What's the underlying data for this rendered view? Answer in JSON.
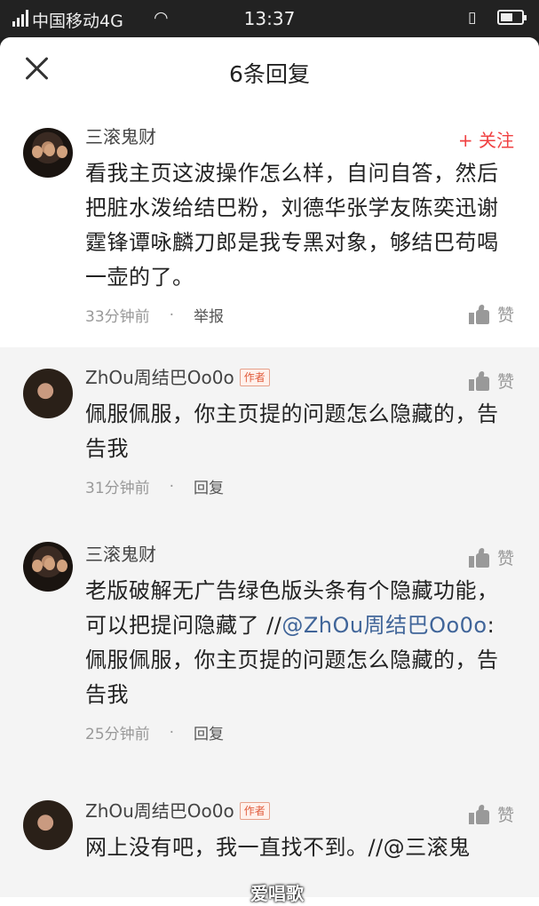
{
  "status_bar": {
    "carrier": "中国移动4G",
    "time": "13:37",
    "battery_level": 0.6
  },
  "header": {
    "title": "6条回复"
  },
  "main_comment": {
    "author": "三滚鬼财",
    "follow_label": "+ 关注",
    "text": "看我主页这波操作怎么样，自问自答，然后把脏水泼给结巴粉，刘德华张学友陈奕迅谢霆锋谭咏麟刀郎是我专黑对象，够结巴苟喝一壶的了。",
    "time": "33分钟前",
    "action_label": "举报",
    "like_label": "赞"
  },
  "replies": [
    {
      "author": "ZhOu周结巴Oo0o",
      "tag": "作者",
      "text": "佩服佩服，你主页提的问题怎么隐藏的，告告我",
      "time": "31分钟前",
      "action_label": "回复",
      "like_label": "赞"
    },
    {
      "author": "三滚鬼财",
      "text_before": "老版破解无广告绿色版头条有个隐藏功能，可以把提问隐藏了 //",
      "mention": "@ZhOu周结巴Oo0o",
      "text_after": ": 佩服佩服，你主页提的问题怎么隐藏的，告告我",
      "time": "25分钟前",
      "action_label": "回复",
      "like_label": "赞"
    },
    {
      "author": "ZhOu周结巴Oo0o",
      "tag": "作者",
      "text": "网上没有吧，我一直找不到。//@三滚鬼",
      "like_label": "赞"
    }
  ],
  "watermark": "爱唱歌"
}
